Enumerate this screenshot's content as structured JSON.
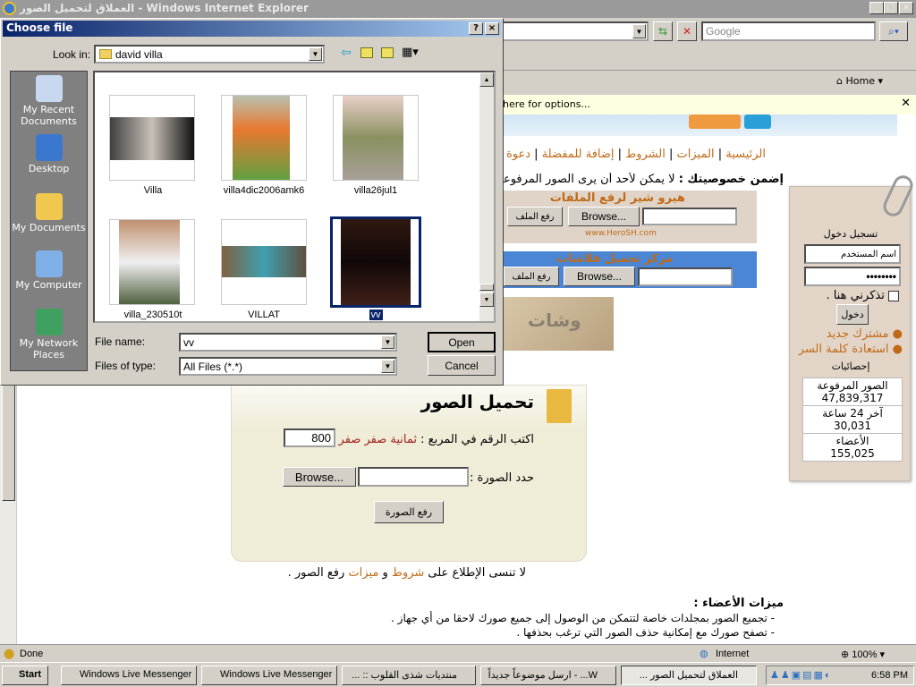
{
  "browser": {
    "title": "العملاق لتحميل الصور - Windows Internet Explorer",
    "search_placeholder": "Google",
    "home_label": "Home",
    "infobar_text": "here for options...",
    "status": "Done",
    "zone": "Internet",
    "zoom": "100%"
  },
  "page": {
    "nav": [
      "الرئيسية",
      "الميزات",
      "الشروط",
      "إضافة للمفضلة",
      "دعوة"
    ],
    "privacy_bold": "إضمن خصوصيتك :",
    "privacy_text": "لا يمكن لأحد أن يرى الصور المرفوعة",
    "hero": {
      "title": "هيرو شير لرفع الملفات",
      "browse": "Browse...",
      "upload": "رفع الملف",
      "url": "www.HeroSH.com"
    },
    "flash": {
      "title": "مركز تحميل فلاشات",
      "browse": "Browse...",
      "upload": "رفع الملف"
    },
    "banner_text": "وشات",
    "login": {
      "title": "تسجيل دخول",
      "username_placeholder": "اسم المستخدم",
      "password": "••••••••",
      "remember": "تذكرني هنا .",
      "submit": "دخول",
      "links": [
        "مشترك جديد",
        "استعادة كلمة السر"
      ],
      "stats_title": "إحصائيات",
      "stats": [
        {
          "label": "الصور المرفوعة",
          "value": "47,839,317"
        },
        {
          "label": "آخر 24 ساعة",
          "value": "30,031"
        },
        {
          "label": "الأعضاء",
          "value": "155,025"
        }
      ]
    },
    "upload": {
      "title": "تحميل الصور",
      "captcha_label": "اكتب الرقم في المربع :",
      "captcha_words": "ثمانية صفر صفر",
      "captcha_value": "800",
      "file_label": "حدد الصورة :",
      "browse": "Browse...",
      "submit": "رفع الصورة"
    },
    "reminder": {
      "pre": "لا تنسى الإطلاع على",
      "terms": "شروط",
      "and": "و",
      "features": "ميزات",
      "post": "رفع الصور ."
    },
    "features": {
      "title": "ميزات الأعضاء :",
      "items": [
        "- تجميع الصور بمجلدات خاصة لتتمكن من الوصول إلى جميع صورك لاحقا من أي جهاز .",
        "- تصفح صورك مع إمكانية حذف الصور التي ترغب بحذفها ."
      ]
    }
  },
  "dialog": {
    "title": "Choose file",
    "look_in_label": "Look in:",
    "look_in_value": "david villa",
    "places": [
      "My Recent Documents",
      "Desktop",
      "My Documents",
      "My Computer",
      "My Network Places"
    ],
    "files": [
      {
        "name": "Villa"
      },
      {
        "name": "villa4dic2006amk6"
      },
      {
        "name": "villa26jul1"
      },
      {
        "name": "villa_230510t"
      },
      {
        "name": "VILLAT"
      },
      {
        "name": "vv",
        "selected": true
      }
    ],
    "file_name_label": "File name:",
    "file_name_value": "vv",
    "file_type_label": "Files of type:",
    "file_type_value": "All Files (*.*)",
    "open": "Open",
    "cancel": "Cancel"
  },
  "taskbar": {
    "start": "Start",
    "items": [
      "Windows Live Messenger",
      "Windows Live Messenger",
      "منتديات شذى القلوب :: ...",
      "W... - ارسل موضوعاً جديداً",
      "العملاق لتحميل الصور ..."
    ],
    "clock": "6:58 PM"
  },
  "colors": {
    "accent": "#c06a18",
    "dialog_title": "#0a246a",
    "hero_bg": "#e0d4c8",
    "flash_bg": "#4a86d4",
    "upload_bg": "#efecd8"
  }
}
